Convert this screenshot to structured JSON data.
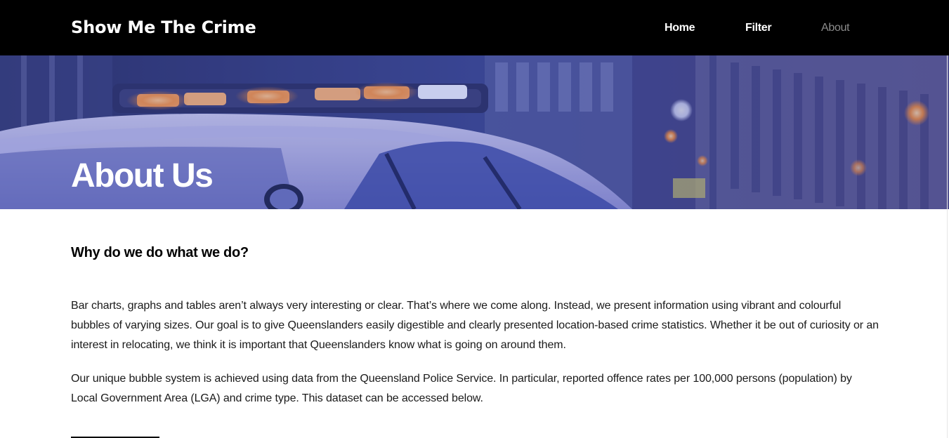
{
  "header": {
    "brand": "Show Me The Crime",
    "nav": {
      "home": "Home",
      "filter": "Filter",
      "about": "About"
    },
    "active_nav": "About"
  },
  "hero": {
    "title": "About Us",
    "overlay_color": "#3a4aa0"
  },
  "main": {
    "heading": "Why do we do what we do?",
    "paragraphs": [
      "Bar charts, graphs and tables aren’t always very interesting or clear. That’s where we come along. Instead, we present information using vibrant and colourful bubbles of varying sizes. Our goal is to give Queenslanders easily digestible and clearly presented location-based crime statistics. Whether it be out of curiosity or an interest in relocating, we think it is important that Queenslanders know what is going on around them.",
      "Our unique bubble system is achieved using data from the Queensland Police Service. In particular, reported offence rates per 100,000 persons (population) by Local Government Area (LGA) and crime type. This dataset can be accessed below."
    ]
  },
  "colors": {
    "topbar": "#000000",
    "nav_active": "#8c8c8c",
    "nav_default": "#ffffff"
  }
}
